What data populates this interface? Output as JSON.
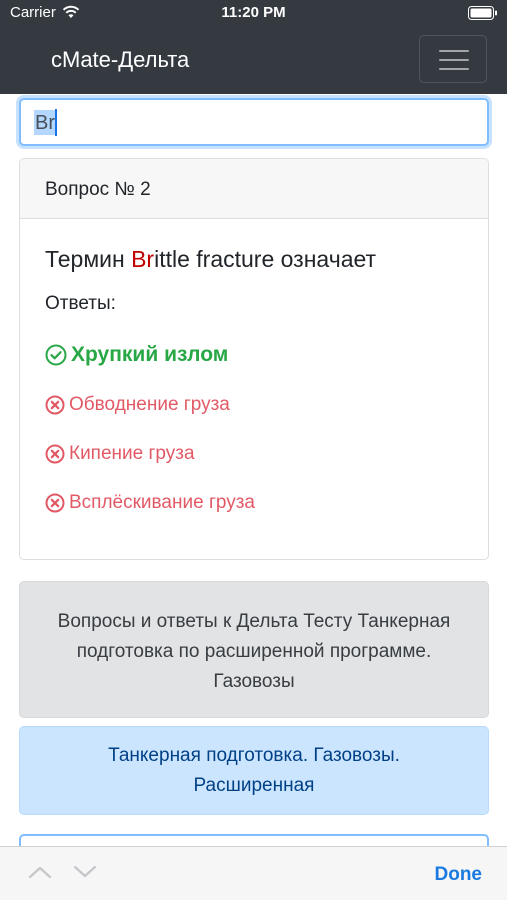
{
  "status_bar": {
    "carrier": "Carrier",
    "time": "11:20 PM"
  },
  "navbar": {
    "brand": "cMate-Дельта",
    "menu_icon": "hamburger-icon"
  },
  "search": {
    "value": "Br"
  },
  "question": {
    "header": "Вопрос № 2",
    "title_highlight": "Br",
    "title_rest": "ittle fracture означает",
    "title_prefix": "Термин ",
    "answers_label": "Ответы:",
    "answers": [
      {
        "text": "Хрупкий излом",
        "correct": true,
        "icon": "check-circle-icon"
      },
      {
        "text": "Обводнение груза",
        "correct": false,
        "icon": "x-circle-icon"
      },
      {
        "text": "Кипение груза",
        "correct": false,
        "icon": "x-circle-icon"
      },
      {
        "text": "Всплёскивание груза",
        "correct": false,
        "icon": "x-circle-icon"
      }
    ]
  },
  "info_text": "Вопросы и ответы к Дельта Тесту Танкерная подготовка по расширенной программе. Газовозы",
  "link_text": "Танкерная подготовка. Газовозы. Расширенная",
  "accessory": {
    "done_label": "Done",
    "prev_icon": "chevron-up-icon",
    "next_icon": "chevron-down-icon"
  },
  "colors": {
    "navbar_bg": "#343a40",
    "correct": "#28a745",
    "wrong": "#dc3545",
    "highlight": "#c00000",
    "link_box_bg": "#cce5ff",
    "info_box_bg": "#e2e3e5",
    "done": "#1a7ae0"
  }
}
